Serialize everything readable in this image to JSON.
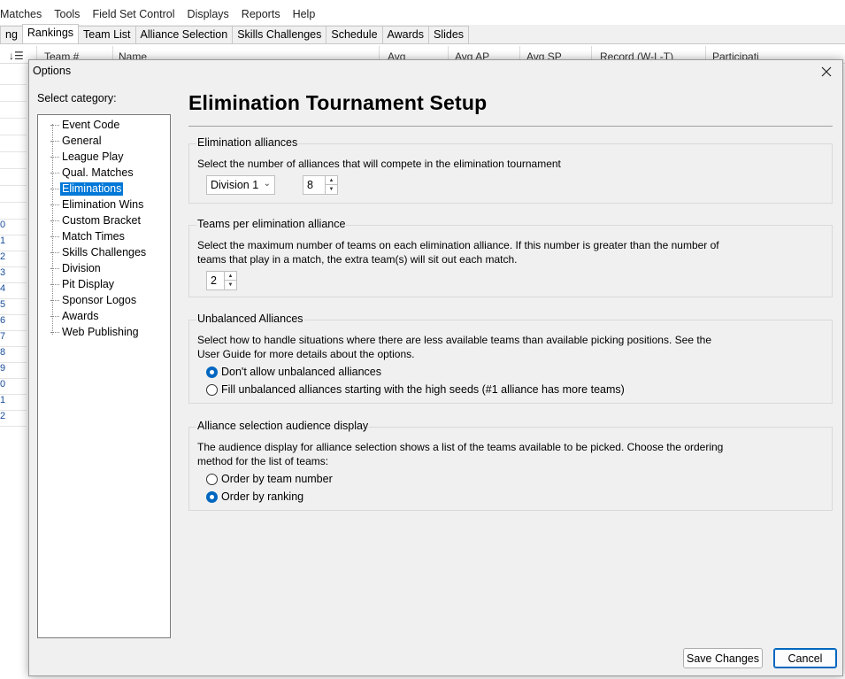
{
  "app": {
    "menu": [
      "Matches",
      "Tools",
      "Field Set Control",
      "Displays",
      "Reports",
      "Help"
    ],
    "tabs": [
      "ng",
      "Rankings",
      "Team List",
      "Alliance Selection",
      "Skills Challenges",
      "Schedule",
      "Awards",
      "Slides"
    ],
    "active_tab": "Rankings",
    "grid_headers": [
      "Team #",
      "Name",
      "Avg",
      "Avg AP",
      "Avg SP",
      "Record (W-L-T)",
      "Participati"
    ],
    "row_stubs": [
      "0",
      "1",
      "2",
      "3",
      "4",
      "5",
      "6",
      "7",
      "8",
      "9",
      "0",
      "1",
      "2"
    ]
  },
  "dialog": {
    "title": "Options",
    "close_icon": "close-icon",
    "category_label": "Select category:",
    "categories": [
      "Event Code",
      "General",
      "League Play",
      "Qual. Matches",
      "Eliminations",
      "Elimination Wins",
      "Custom Bracket",
      "Match Times",
      "Skills Challenges",
      "Division",
      "Pit Display",
      "Sponsor Logos",
      "Awards",
      "Web Publishing"
    ],
    "selected_category": "Eliminations",
    "page_title": "Elimination Tournament Setup",
    "groups": {
      "alliances": {
        "title": "Elimination alliances",
        "desc": "Select the number of alliances that will compete in the elimination tournament",
        "division": "Division 1",
        "count": "8"
      },
      "teams": {
        "title": "Teams per elimination alliance",
        "desc": "Select the maximum number of teams on each elimination alliance.  If this number is greater than the number of teams that play in a match, the extra team(s) will sit out each match.",
        "count": "2"
      },
      "unbalanced": {
        "title": "Unbalanced Alliances",
        "desc": "Select how to handle situations where there are less available teams than available picking positions.  See the User Guide for more details about the options.",
        "options": [
          "Don't allow unbalanced alliances",
          "Fill unbalanced alliances starting with the high seeds (#1 alliance has more teams)"
        ],
        "selected": 0
      },
      "audience": {
        "title": "Alliance selection audience display",
        "desc": "The audience display for alliance selection shows a list of the teams available to be picked.  Choose the ordering method for the list of teams:",
        "options": [
          "Order by team number",
          "Order by ranking"
        ],
        "selected": 1
      }
    },
    "buttons": {
      "save": "Save Changes",
      "cancel": "Cancel"
    }
  },
  "colors": {
    "selection": "#0078d7",
    "accent": "#0067c0"
  }
}
